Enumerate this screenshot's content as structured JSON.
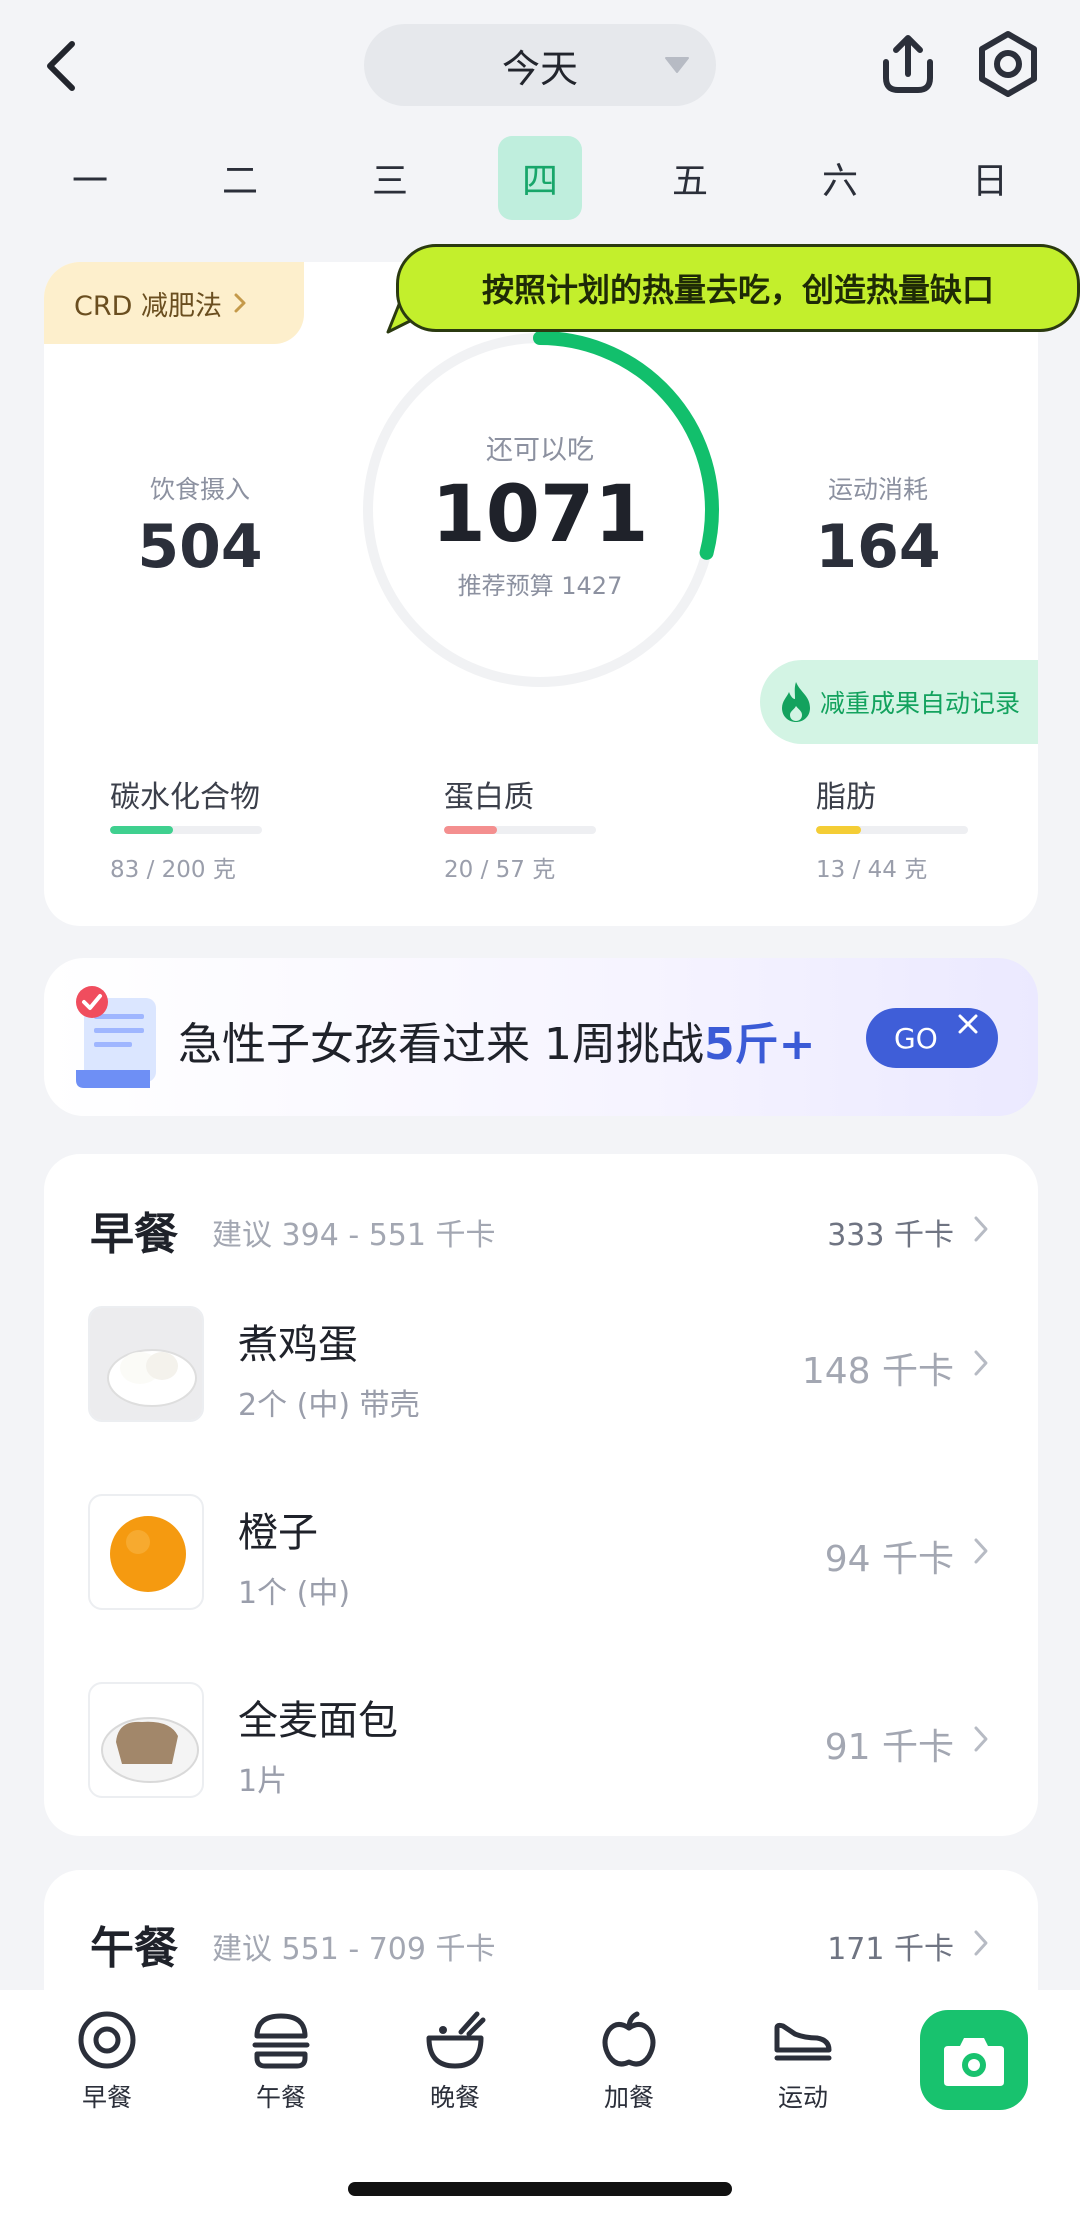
{
  "header": {
    "date_label": "今天"
  },
  "week": {
    "days": [
      "一",
      "二",
      "三",
      "四",
      "五",
      "六",
      "日"
    ],
    "active_index": 3
  },
  "summary": {
    "plan_label": "CRD 减肥法",
    "tip_bubble": "按照计划的热量去吃，创造热量缺口",
    "intake_label": "饮食摄入",
    "intake_value": "504",
    "remaining_label": "还可以吃",
    "remaining_value": "1071",
    "budget_label": "推荐预算 1427",
    "exercise_label": "运动消耗",
    "exercise_value": "164",
    "auto_record_label": "减重成果自动记录",
    "ring_progress": 0.29,
    "macros": [
      {
        "name": "碳水化合物",
        "value": "83 / 200 克",
        "fraction": 0.415,
        "color": "#3fd08f"
      },
      {
        "name": "蛋白质",
        "value": "20 / 57 克",
        "fraction": 0.351,
        "color": "#f48f8f"
      },
      {
        "name": "脂肪",
        "value": "13 / 44 克",
        "fraction": 0.295,
        "color": "#f4cd35"
      }
    ]
  },
  "promo": {
    "text_main": "急性子女孩看过来 1周挑战",
    "text_highlight": "5斤+",
    "button_label": "GO"
  },
  "meals": {
    "breakfast": {
      "title": "早餐",
      "suggest": "建议 394 - 551 千卡",
      "total": "333 千卡",
      "items": [
        {
          "name": "煮鸡蛋",
          "portion": "2个 (中) 带壳",
          "kcal": "148 千卡"
        },
        {
          "name": "橙子",
          "portion": "1个 (中)",
          "kcal": "94 千卡"
        },
        {
          "name": "全麦面包",
          "portion": "1片",
          "kcal": "91 千卡"
        }
      ]
    },
    "lunch": {
      "title": "午餐",
      "suggest": "建议 551 - 709 千卡",
      "total": "171 千卡"
    }
  },
  "bottom_nav": {
    "items": [
      {
        "label": "早餐",
        "icon": "plate-icon"
      },
      {
        "label": "午餐",
        "icon": "burger-icon"
      },
      {
        "label": "晚餐",
        "icon": "bowl-icon"
      },
      {
        "label": "加餐",
        "icon": "apple-icon"
      },
      {
        "label": "运动",
        "icon": "shoe-icon"
      }
    ],
    "camera_icon": "camera-icon"
  },
  "colors": {
    "accent_green": "#18c26e",
    "ring_green": "#12bf6c",
    "promo_blue": "#3f5ed8",
    "bubble_lime": "#c3ef2c"
  }
}
